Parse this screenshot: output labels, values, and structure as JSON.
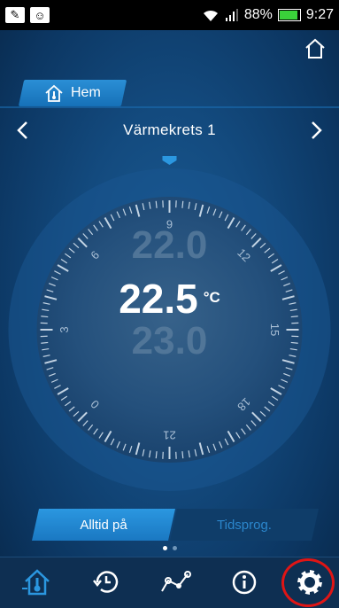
{
  "statusbar": {
    "wifi": "wifi-icon",
    "signal": "signal-icon",
    "battery_percent": "88%",
    "time": "9:27"
  },
  "header": {
    "home_tab_label": "Hem"
  },
  "circuit": {
    "name": "Värmekrets 1"
  },
  "dial": {
    "tick_labels": [
      "0",
      "3",
      "6",
      "9",
      "12",
      "15",
      "18",
      "21"
    ],
    "temp_above": "22.0",
    "temp_current": "22.5",
    "temp_unit": "°C",
    "temp_below": "23.0"
  },
  "mode": {
    "always_on_label": "Alltid på",
    "program_label": "Tidsprog."
  },
  "pager": {
    "count": 2,
    "active_index": 0
  },
  "navbar": {
    "items": [
      "thermostat-home-icon",
      "history-icon",
      "graph-icon",
      "info-icon",
      "settings-icon"
    ]
  },
  "colors": {
    "accent": "#2b97e0",
    "highlight": "#e01515"
  }
}
